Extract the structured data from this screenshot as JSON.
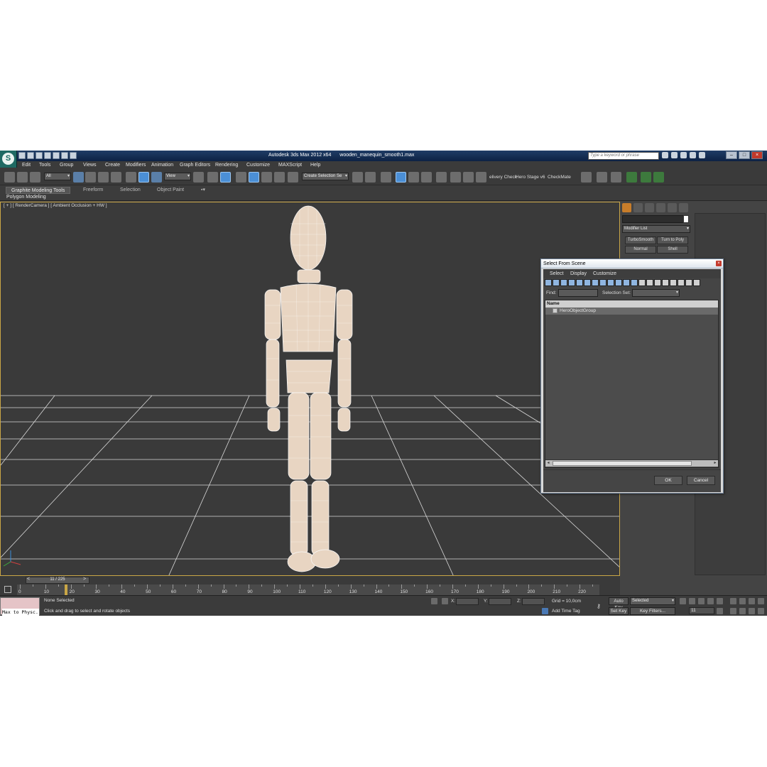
{
  "app": {
    "title": "Autodesk 3ds Max  2012 x64",
    "file": "wooden_manequin_smooth1.max",
    "logo": "S",
    "search_placeholder": "Type a keyword or phrase"
  },
  "menu": [
    "Edit",
    "Tools",
    "Group",
    "Views",
    "Create",
    "Modifiers",
    "Animation",
    "Graph Editors",
    "Rendering",
    "Customize",
    "MAXScript",
    "Help"
  ],
  "toolbar": {
    "filter_value": "All",
    "ref_coord_value": "View",
    "selection_set_placeholder": "Create Selection Se",
    "text_buttons": [
      "elivery Check",
      "Hero Stage v6",
      "CheckMate"
    ]
  },
  "ribbon": {
    "tabs": [
      "Graphite Modeling Tools",
      "Freeform",
      "Selection",
      "Object Paint"
    ],
    "sub_label": "Polygon Modeling"
  },
  "viewport": {
    "label": "[ + ] [ RenderCamera ] [ Ambient Occlusion + HW ]"
  },
  "command_panel": {
    "modifier_list": "Modifier List",
    "modifier_buttons": [
      "TurboSmooth",
      "Turn to Poly",
      "Normal",
      "Shell"
    ]
  },
  "timeline": {
    "frame_display": "11 / 225",
    "prev": "<",
    "next": ">",
    "ticks": [
      "0",
      "10",
      "20",
      "30",
      "40",
      "50",
      "60",
      "70",
      "80",
      "90",
      "100",
      "110",
      "120",
      "130",
      "140",
      "150",
      "160",
      "170",
      "180",
      "190",
      "200",
      "210",
      "220"
    ]
  },
  "status": {
    "maxscript": "Max to Physc.",
    "selection": "None Selected",
    "prompt": "Click and drag to select and rotate objects",
    "x_label": "X:",
    "y_label": "Y:",
    "z_label": "Z:",
    "grid": "Grid = 10,0cm",
    "add_time_tag": "Add Time Tag",
    "auto_key": "Auto Key",
    "set_key": "Set Key",
    "key_mode": "Selected",
    "key_filters": "Key Filters...",
    "current_frame": "11"
  },
  "dialog": {
    "title": "Select From Scene",
    "menu": [
      "Select",
      "Display",
      "Customize"
    ],
    "find_label": "Find:",
    "selection_set_label": "Selection Set:",
    "column_name": "Name",
    "items": [
      "HeroObjectGroup"
    ],
    "ok": "OK",
    "cancel": "Cancel"
  }
}
